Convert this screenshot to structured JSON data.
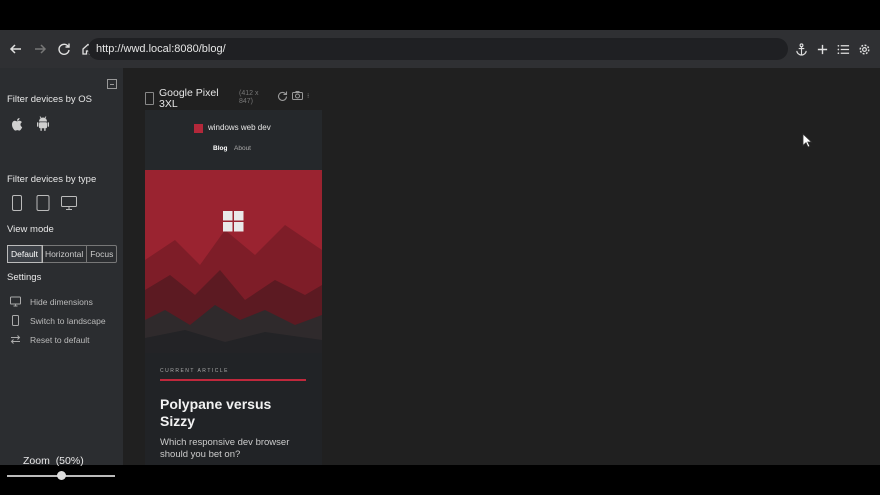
{
  "browser": {
    "url": "http://wwd.local:8080/blog/"
  },
  "sidebar": {
    "filter_os_label": "Filter devices by OS",
    "filter_type_label": "Filter devices by type",
    "view_mode_label": "View mode",
    "view_modes": [
      "Default",
      "Horizontal",
      "Focus"
    ],
    "settings_label": "Settings",
    "settings_items": [
      "Hide dimensions",
      "Switch to landscape",
      "Reset to default"
    ],
    "zoom_label": "Zoom",
    "zoom_value": "(50%)",
    "zoom_fraction": 0.5
  },
  "device": {
    "name": "Google Pixel 3XL",
    "dimensions": "(412 x 847)"
  },
  "site": {
    "name": "windows web dev",
    "nav": [
      "Blog",
      "About"
    ],
    "kicker": "CURRENT ARTICLE",
    "article_title": "Polypane versus Sizzy",
    "article_subtitle": "Which responsive dev browser should you bet on?",
    "accent_color": "#b3283a"
  },
  "icons": {
    "back": "arrow-left-icon",
    "forward": "arrow-right-icon",
    "reload": "reload-icon",
    "home": "home-icon",
    "anchor": "anchor-icon",
    "add": "plus-icon",
    "list": "list-icon",
    "settings": "gear-icon"
  }
}
